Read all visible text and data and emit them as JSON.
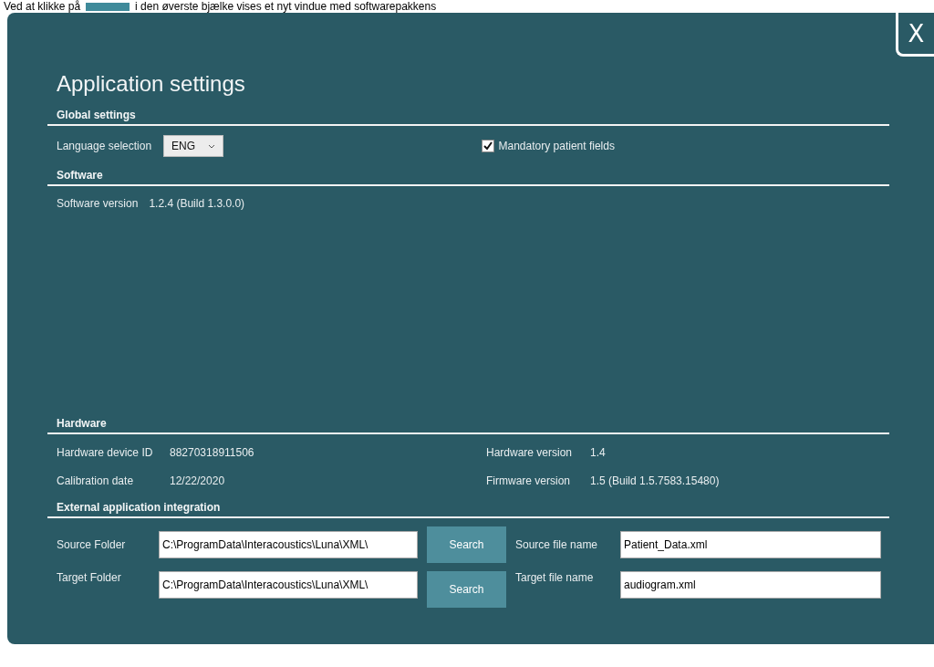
{
  "instruction": {
    "before": "Ved at klikke på",
    "after": "i den øverste bjælke vises et nyt vindue med softwarepakkens"
  },
  "dialog": {
    "close": "X",
    "title": "Application settings"
  },
  "global_settings": {
    "heading": "Global settings",
    "language": {
      "label": "Language selection",
      "value": "ENG"
    },
    "mandatory": {
      "label": "Mandatory patient fields",
      "checked": true
    }
  },
  "software": {
    "heading": "Software",
    "rows": [
      {
        "label": "Software version",
        "value": "1.2.4 (Build 1.3.0.0)"
      }
    ]
  },
  "hardware": {
    "heading": "Hardware",
    "rows": [
      {
        "label": "Hardware device ID",
        "value": "88270318911506"
      },
      {
        "label": "Hardware version",
        "value": "1.4"
      },
      {
        "label": "Calibration date",
        "value": "12/22/2020"
      },
      {
        "label": "Firmware version",
        "value": "1.5 (Build 1.5.7583.15480)"
      }
    ]
  },
  "integration": {
    "heading": "External application integration",
    "rows": [
      {
        "folder_label": "Source Folder",
        "folder": "C:\\ProgramData\\Interacoustics\\Luna\\XML\\",
        "button": "Search",
        "file_label": "Source file name",
        "file": "Patient_Data.xml"
      },
      {
        "folder_label": "Target Folder",
        "folder": "C:\\ProgramData\\Interacoustics\\Luna\\XML\\",
        "button": "Search",
        "file_label": "Target file name",
        "file": "audiogram.xml"
      }
    ]
  }
}
